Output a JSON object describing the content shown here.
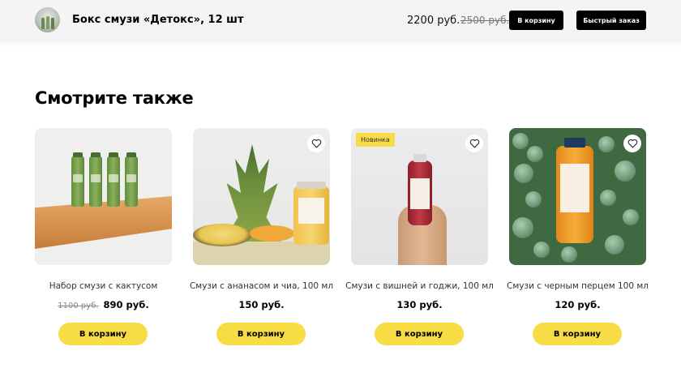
{
  "header": {
    "product_title": "Бокс смузи «Детокс», 12 шт",
    "price": "2200 руб.",
    "old_price": "2500 руб.",
    "cart_label": "В корзину",
    "quick_order_label": "Быстрый заказ"
  },
  "section": {
    "title": "Смотрите также"
  },
  "products": [
    {
      "name": "Набор смузи с кактусом",
      "old_price": "1100 руб.",
      "price": "890 руб.",
      "cart_label": "В корзину",
      "badge": ""
    },
    {
      "name": "Смузи с ананасом и чиа, 100 мл",
      "old_price": "",
      "price": "150 руб.",
      "cart_label": "В корзину",
      "badge": ""
    },
    {
      "name": "Смузи с вишней и годжи, 100 мл",
      "old_price": "",
      "price": "130 руб.",
      "cart_label": "В корзину",
      "badge": "Новинка"
    },
    {
      "name": "Смузи с черным перцем 100 мл",
      "old_price": "",
      "price": "120 руб.",
      "cart_label": "В корзину",
      "badge": ""
    }
  ],
  "icons": {
    "favorite": "heart-outline-icon"
  },
  "colors": {
    "accent_yellow": "#f7dc45",
    "button_black": "#000000",
    "topbar_bg": "#f4f4f4"
  }
}
